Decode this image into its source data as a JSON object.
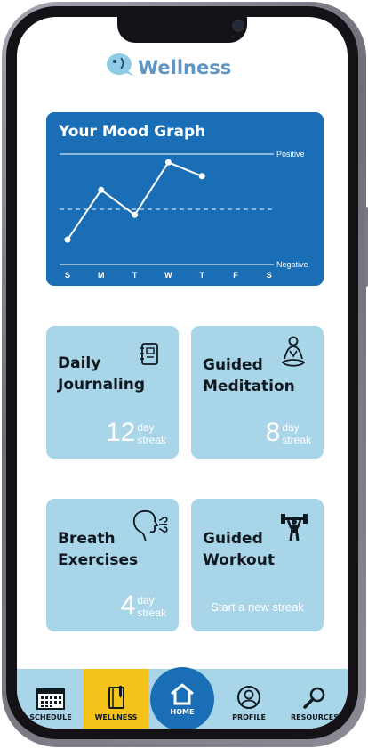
{
  "app": {
    "title": "Wellness"
  },
  "mood_graph": {
    "title": "Your Mood Graph",
    "top_label": "Positive",
    "bottom_label": "Negative",
    "days": [
      "S",
      "M",
      "T",
      "W",
      "T",
      "F",
      "S"
    ],
    "chart_data": {
      "type": "line",
      "title": "Your Mood Graph",
      "categories": [
        "S",
        "M",
        "T",
        "W",
        "T",
        "F",
        "S"
      ],
      "values": [
        -0.55,
        0.35,
        -0.1,
        0.85,
        0.6,
        null,
        null
      ],
      "ylim": [
        -1,
        1
      ],
      "y_axis_labels": {
        "top": "Positive",
        "bottom": "Negative"
      },
      "baseline": 0,
      "colors": {
        "background": "#1a6eb5",
        "line": "#ffffff"
      }
    }
  },
  "cards": [
    {
      "title": "Daily\nJournaling",
      "icon": "journal-icon",
      "streak_value": "12",
      "streak_unit_1": "day",
      "streak_unit_2": "streak"
    },
    {
      "title": "Guided\nMeditation",
      "icon": "meditation-icon",
      "streak_value": "8",
      "streak_unit_1": "day",
      "streak_unit_2": "streak"
    },
    {
      "title": "Breath\nExercises",
      "icon": "breathing-icon",
      "streak_value": "4",
      "streak_unit_1": "day",
      "streak_unit_2": "streak"
    },
    {
      "title": "Guided\nWorkout",
      "icon": "dumbbell-icon",
      "start_text": "Start a new streak"
    }
  ],
  "tabbar": {
    "items": [
      {
        "label": "SCHEDULE",
        "icon": "calendar-icon"
      },
      {
        "label": "WELLNESS",
        "icon": "notebook-icon",
        "active": true
      },
      {
        "label": "HOME",
        "icon": "home-icon"
      },
      {
        "label": "PROFILE",
        "icon": "profile-icon"
      },
      {
        "label": "RESOURCES",
        "icon": "search-icon"
      }
    ]
  },
  "colors": {
    "brand_blue": "#1a6eb5",
    "card_light_blue": "#a8d5e8",
    "active_tab_yellow": "#f5c21a",
    "logo_text": "#5e95c4"
  }
}
